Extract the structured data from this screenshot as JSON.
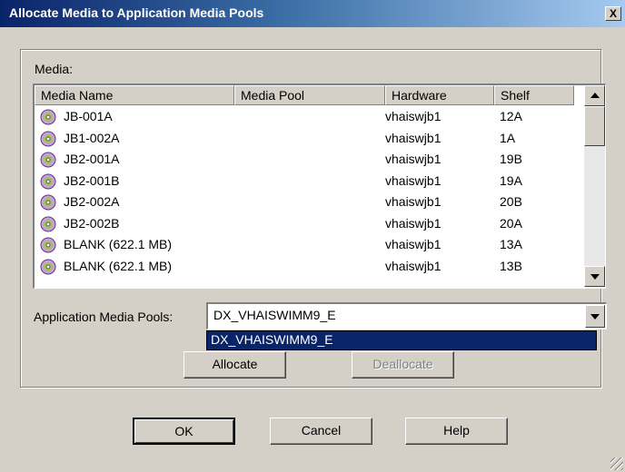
{
  "window": {
    "title": "Allocate Media to Application Media Pools",
    "close_label": "X"
  },
  "media": {
    "label": "Media:",
    "columns": [
      "Media Name",
      "Media Pool",
      "Hardware",
      "Shelf"
    ],
    "rows": [
      {
        "name": "JB-001A",
        "pool": "",
        "hardware": "vhaiswjb1",
        "shelf": "12A"
      },
      {
        "name": "JB1-002A",
        "pool": "",
        "hardware": "vhaiswjb1",
        "shelf": "1A"
      },
      {
        "name": "JB2-001A",
        "pool": "",
        "hardware": "vhaiswjb1",
        "shelf": "19B"
      },
      {
        "name": "JB2-001B",
        "pool": "",
        "hardware": "vhaiswjb1",
        "shelf": "19A"
      },
      {
        "name": "JB2-002A",
        "pool": "",
        "hardware": "vhaiswjb1",
        "shelf": "20B"
      },
      {
        "name": "JB2-002B",
        "pool": "",
        "hardware": "vhaiswjb1",
        "shelf": "20A"
      },
      {
        "name": "BLANK (622.1 MB)",
        "pool": "",
        "hardware": "vhaiswjb1",
        "shelf": "13A"
      },
      {
        "name": "BLANK (622.1 MB)",
        "pool": "",
        "hardware": "vhaiswjb1",
        "shelf": "13B"
      }
    ],
    "row_icon": "optical-disc-icon"
  },
  "pools": {
    "label": "Application Media Pools:",
    "selected": "DX_VHAISWIMM9_E",
    "options": [
      "DX_VHAISWIMM9_E"
    ]
  },
  "buttons": {
    "allocate": "Allocate",
    "deallocate": "Deallocate",
    "ok": "OK",
    "cancel": "Cancel",
    "help": "Help"
  },
  "colors": {
    "titlebar_start": "#0a246a",
    "titlebar_end": "#a6caf0",
    "selection": "#0a246a",
    "face": "#d4d0c8"
  }
}
